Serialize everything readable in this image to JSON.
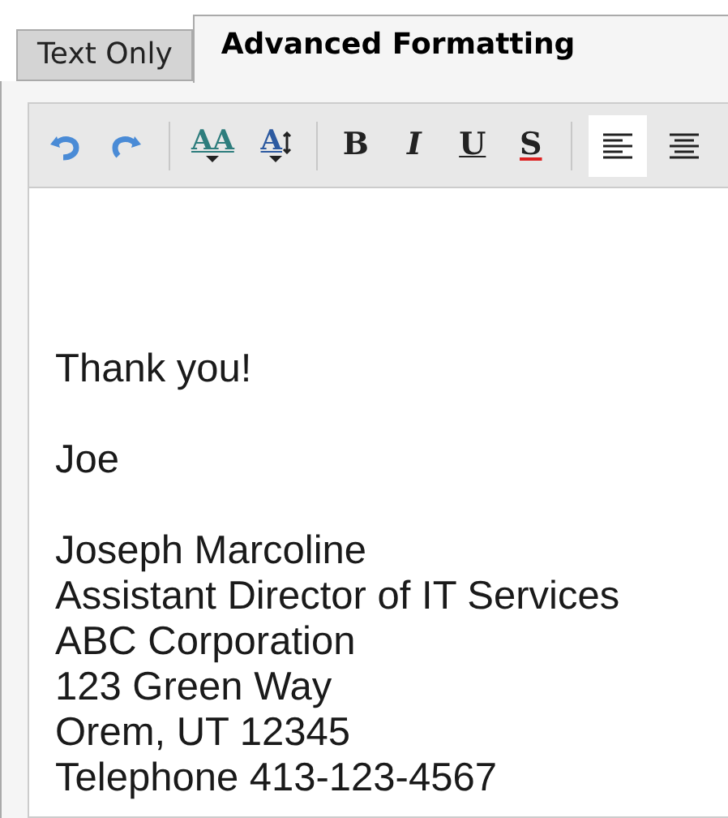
{
  "tabs": [
    {
      "label": "Text Only",
      "selected": false
    },
    {
      "label": "Advanced Formatting",
      "selected": true
    }
  ],
  "toolbar": [
    {
      "kind": "undo",
      "selected": false
    },
    {
      "kind": "redo",
      "selected": false
    },
    {
      "kind": "separator"
    },
    {
      "kind": "fontsize",
      "label": "AA",
      "selected": false
    },
    {
      "kind": "lineheight",
      "label": "A",
      "selected": false
    },
    {
      "kind": "separator"
    },
    {
      "kind": "bold",
      "label": "B",
      "selected": false
    },
    {
      "kind": "italic",
      "label": "I",
      "selected": false
    },
    {
      "kind": "underline",
      "label": "U",
      "selected": false
    },
    {
      "kind": "strike",
      "label": "S",
      "selected": false
    },
    {
      "kind": "separator"
    },
    {
      "kind": "alignleft",
      "selected": true
    },
    {
      "kind": "aligncenter",
      "selected": false
    }
  ],
  "body": [
    {
      "lines": [
        "Thank you!"
      ]
    },
    {
      "lines": [
        "Joe"
      ]
    },
    {
      "lines": [
        "Joseph Marcoline",
        "Assistant Director of IT Services",
        "ABC Corporation",
        "123 Green Way",
        "Orem, UT 12345",
        "Telephone 413-123-4567"
      ]
    }
  ]
}
